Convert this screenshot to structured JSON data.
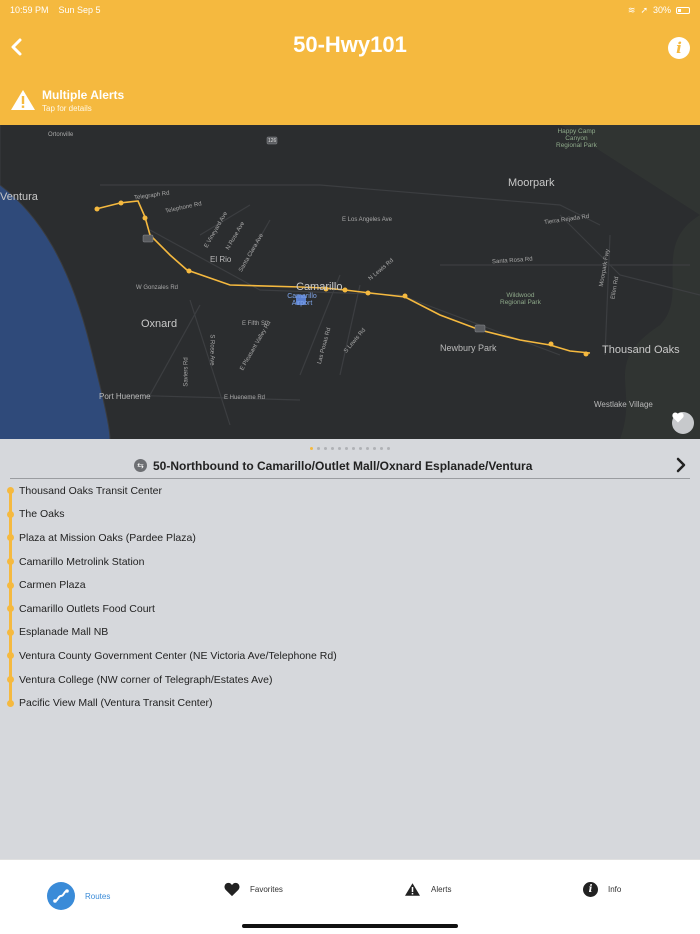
{
  "status_bar": {
    "time": "10:59 PM",
    "date": "Sun Sep 5",
    "battery": "30%"
  },
  "header": {
    "title": "50-Hwy101",
    "back_icon": "chevron-left-icon",
    "info_icon": "info-icon",
    "alert": {
      "title": "Multiple Alerts",
      "subtitle": "Tap for details",
      "icon": "warning-icon"
    }
  },
  "map": {
    "places": {
      "ventura": "Ventura",
      "moorpark": "Moorpark",
      "el_rio": "El Rio",
      "camarillo": "Camarillo",
      "oxnard": "Oxnard",
      "newbury_park": "Newbury Park",
      "thousand_oaks": "Thousand Oaks",
      "port_hueneme": "Port Hueneme",
      "westlake_village": "Westlake Village",
      "ortonville": "Ortonville"
    },
    "parks": {
      "happy_camp": "Happy Camp\nCanyon\nRegional Park",
      "wildwood": "Wildwood\nRegional Park"
    },
    "airport": "Camarillo\nAirport",
    "roads": {
      "telegraph": "Telegraph Rd",
      "telephone": "Telephone Rd",
      "e_los_angeles": "E Los Angeles Ave",
      "tierra_rejada": "Tierra Rejada Rd",
      "e_vineyard": "E Vineyard Ave",
      "n_rose": "N Rose Ave",
      "santa_clara": "Santa Clara Ave",
      "santa_rosa": "Santa Rosa Rd",
      "w_gonzales": "W Gonzales Rd",
      "n_lewis": "N Lewis Rd",
      "e_fifth": "E Fifth St",
      "pleasant_valley": "E Pleasant Valley Rd",
      "los_posas": "Las Posas Rd",
      "s_lewis": "S Lewis Rd",
      "s_rose": "S Rose Ave",
      "saviers": "Saviers Rd",
      "e_hueneme": "E Hueneme Rd",
      "moorpark_fwy": "Moorpark Fwy",
      "ellen": "Ellen Rd",
      "route_126": "126"
    }
  },
  "panel": {
    "direction_title": "50-Northbound to Camarillo/Outlet Mall/Oxnard Esplanade/Ventura",
    "stops": [
      "Thousand Oaks Transit Center",
      "The Oaks",
      "Plaza at Mission Oaks (Pardee Plaza)",
      "Camarillo Metrolink Station",
      "Carmen Plaza",
      "Camarillo Outlets Food Court",
      "Esplanade Mall NB",
      "Ventura County Government Center (NE Victoria Ave/Telephone Rd)",
      "Ventura College (NW corner of Telegraph/Estates Ave)",
      "Pacific View Mall (Ventura Transit Center)"
    ]
  },
  "tabs": [
    {
      "label": "Routes",
      "icon": "routes-icon"
    },
    {
      "label": "Favorites",
      "icon": "heart-icon"
    },
    {
      "label": "Alerts",
      "icon": "warning-icon"
    },
    {
      "label": "Info",
      "icon": "info-icon"
    }
  ],
  "colors": {
    "accent": "#f5b93f",
    "tab_active": "#3a8bd8",
    "map_bg": "#2b2d2f",
    "panel_bg": "#d6d8dc"
  }
}
